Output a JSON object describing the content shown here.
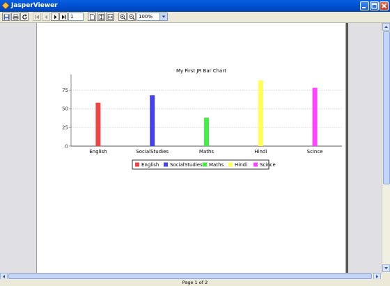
{
  "window": {
    "title": "JasperViewer"
  },
  "toolbar": {
    "page_number": "1",
    "zoom": "100%"
  },
  "status": {
    "page_label": "Page 1 of 2"
  },
  "colors": {
    "titlebar": "#0053d6",
    "page_bg": "#ffffff"
  },
  "chart_data": {
    "type": "bar",
    "title": "My First JR Bar Chart",
    "categories": [
      "English",
      "SocialStudies",
      "Maths",
      "Hindi",
      "Scince"
    ],
    "series": [
      {
        "name": "English",
        "category": "English",
        "value": 58,
        "color": "#ee4444"
      },
      {
        "name": "SocialStudies",
        "category": "SocialStudies",
        "value": 68,
        "color": "#4444ee"
      },
      {
        "name": "Maths",
        "category": "Maths",
        "value": 38,
        "color": "#44ee44"
      },
      {
        "name": "Hindi",
        "category": "Hindi",
        "value": 88,
        "color": "#ffff55"
      },
      {
        "name": "Scince",
        "category": "Scince",
        "value": 78,
        "color": "#ff44ff"
      }
    ],
    "yticks": [
      "0",
      "25",
      "50",
      "75"
    ],
    "ylim": [
      0,
      93
    ],
    "grid": true,
    "legend_position": "bottom"
  }
}
